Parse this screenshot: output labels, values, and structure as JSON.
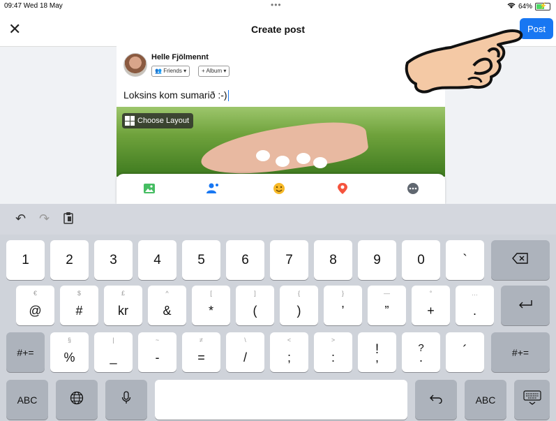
{
  "status_bar": {
    "time": "09:47  Wed 18 May",
    "dots": "•••",
    "battery": "64%"
  },
  "nav": {
    "close": "✕",
    "title": "Create post",
    "post_label": "Post"
  },
  "composer": {
    "user_name": "Helle Fjölmennt",
    "audience": "Friends ▾",
    "album": "+ Album ▾",
    "text": "Loksins kom sumarið :-)",
    "choose_layout": "Choose Layout"
  },
  "keyboard": {
    "row1": [
      "1",
      "2",
      "3",
      "4",
      "5",
      "6",
      "7",
      "8",
      "9",
      "0",
      "`"
    ],
    "row2": [
      {
        "sub": "€",
        "main": "@"
      },
      {
        "sub": "$",
        "main": "#"
      },
      {
        "sub": "£",
        "main": "kr"
      },
      {
        "sub": "^",
        "main": "&"
      },
      {
        "sub": "[",
        "main": "*"
      },
      {
        "sub": "]",
        "main": "("
      },
      {
        "sub": "{",
        "main": ")"
      },
      {
        "sub": "}",
        "main": "’"
      },
      {
        "sub": "—",
        "main": "”"
      },
      {
        "sub": "°",
        "main": "+"
      },
      {
        "sub": "…",
        "main": "."
      }
    ],
    "row3": [
      {
        "sub": "§",
        "main": "%"
      },
      {
        "sub": "|",
        "main": "_"
      },
      {
        "sub": "~",
        "main": "-"
      },
      {
        "sub": "≠",
        "main": "="
      },
      {
        "sub": "\\",
        "main": "/"
      },
      {
        "sub": "<",
        "main": ";"
      },
      {
        "sub": ">",
        "main": ":"
      },
      {
        "sub": "!",
        "main": ","
      },
      {
        "sub": "?",
        "main": "."
      },
      {
        "sub": "",
        "main": "´"
      }
    ],
    "symbols_label": "#+=",
    "abc_label": "ABC"
  }
}
